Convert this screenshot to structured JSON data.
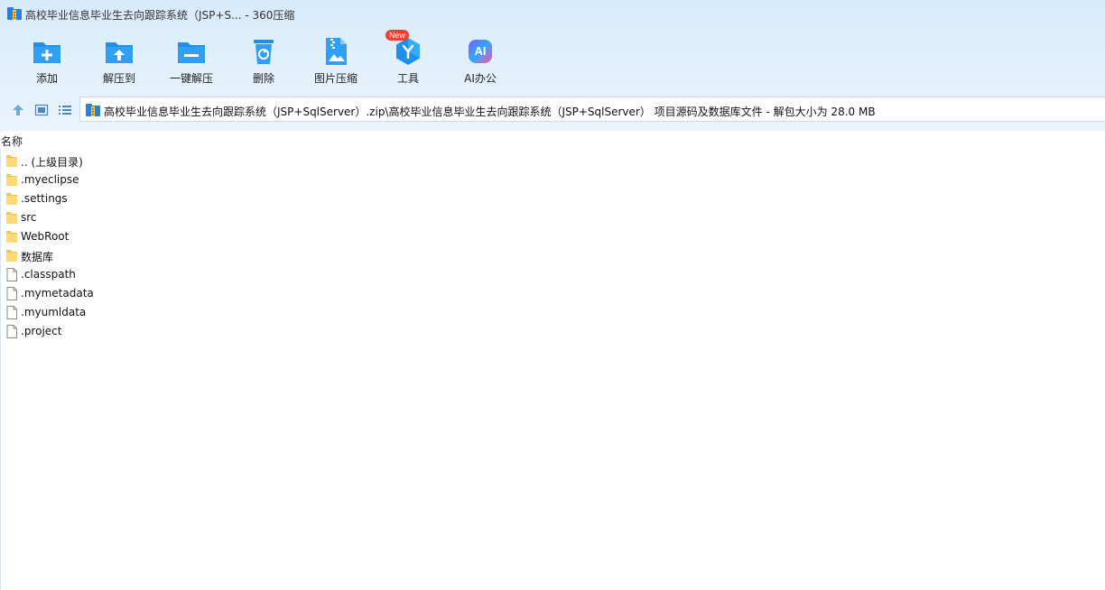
{
  "window": {
    "title": "高校毕业信息毕业生去向跟踪系统（JSP+S... - 360压缩",
    "archive_icon": "archive-icon"
  },
  "toolbar": {
    "add_label": "添加",
    "extract_to_label": "解压到",
    "one_click_extract_label": "一键解压",
    "delete_label": "删除",
    "image_compress_label": "图片压缩",
    "tools_label": "工具",
    "tools_badge": "New",
    "ai_office_label": "AI办公",
    "ai_icon_text": "AI"
  },
  "address": {
    "path": "高校毕业信息毕业生去向跟踪系统（JSP+SqlServer）.zip\\高校毕业信息毕业生去向跟踪系统（JSP+SqlServer） 项目源码及数据库文件 - 解包大小为 28.0 MB"
  },
  "list": {
    "column_name": "名称",
    "items": [
      {
        "name": ".. (上级目录)",
        "type": "folder"
      },
      {
        "name": ".myeclipse",
        "type": "folder"
      },
      {
        "name": ".settings",
        "type": "folder"
      },
      {
        "name": "src",
        "type": "folder"
      },
      {
        "name": "WebRoot",
        "type": "folder"
      },
      {
        "name": "数据库",
        "type": "folder"
      },
      {
        "name": ".classpath",
        "type": "file"
      },
      {
        "name": ".mymetadata",
        "type": "file"
      },
      {
        "name": ".myumldata",
        "type": "file"
      },
      {
        "name": ".project",
        "type": "file"
      }
    ]
  },
  "colors": {
    "toolbar_icon_blue": "#1e90ea",
    "folder_yellow": "#ffd978",
    "badge_red": "#ff3b30"
  }
}
